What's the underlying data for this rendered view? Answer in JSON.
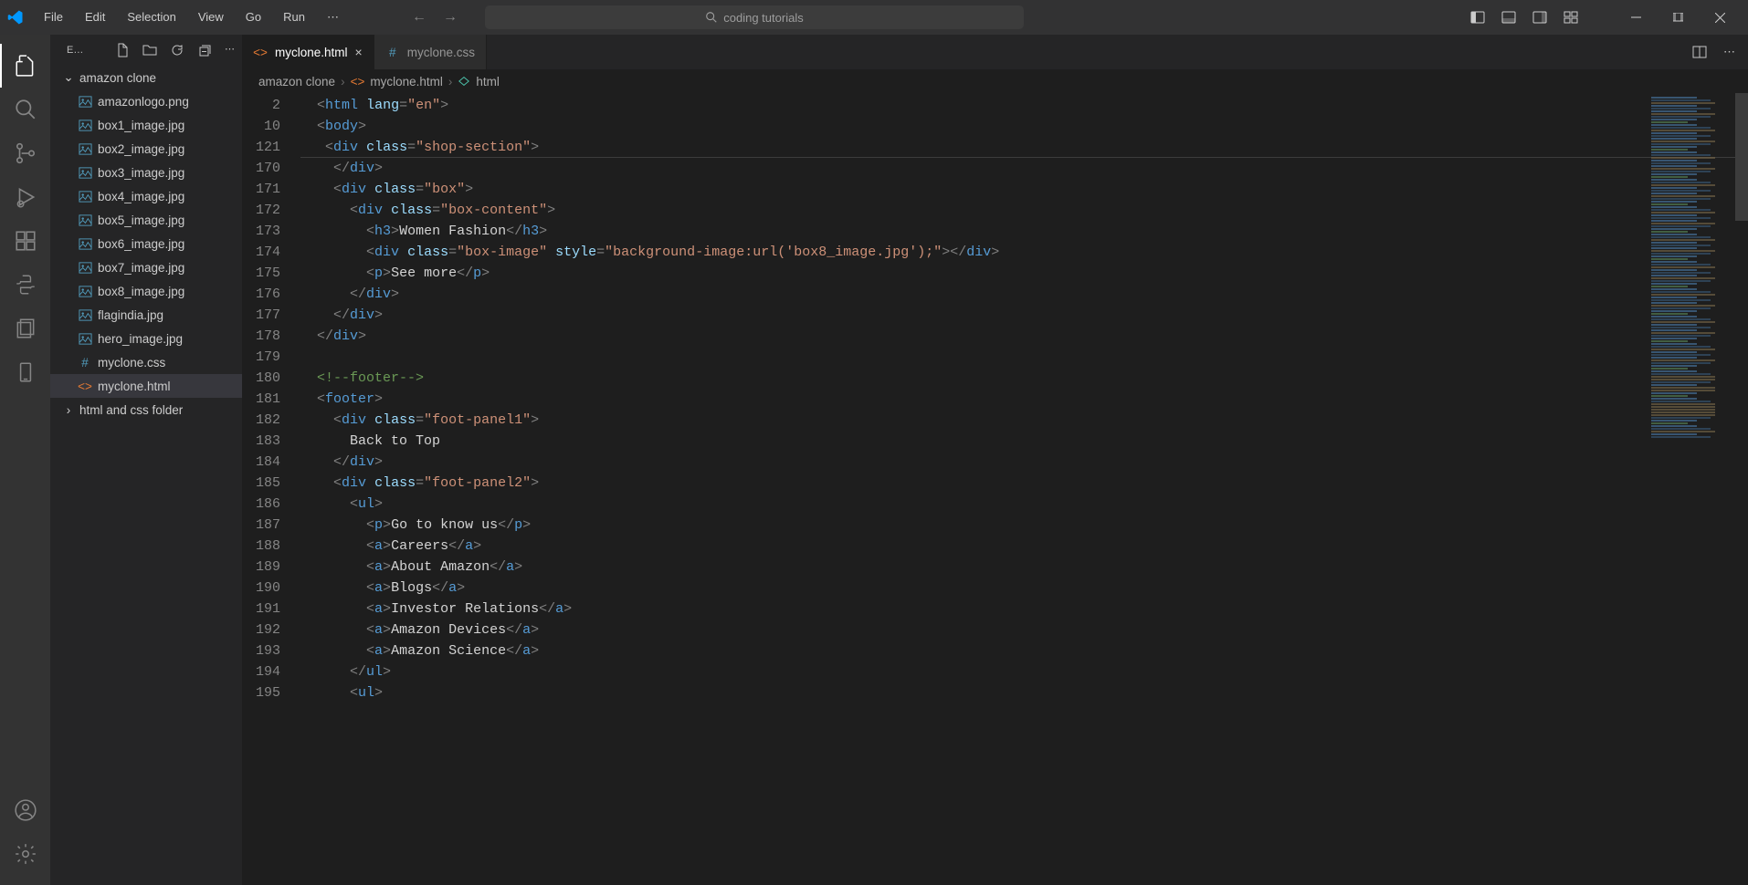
{
  "menu": {
    "items": [
      "File",
      "Edit",
      "Selection",
      "View",
      "Go",
      "Run"
    ]
  },
  "search": {
    "placeholder": "coding tutorials"
  },
  "sidebar": {
    "title": "E…",
    "folder": "amazon clone",
    "files": [
      {
        "name": "amazonlogo.png",
        "icon": "img"
      },
      {
        "name": "box1_image.jpg",
        "icon": "img"
      },
      {
        "name": "box2_image.jpg",
        "icon": "img"
      },
      {
        "name": "box3_image.jpg",
        "icon": "img"
      },
      {
        "name": "box4_image.jpg",
        "icon": "img"
      },
      {
        "name": "box5_image.jpg",
        "icon": "img"
      },
      {
        "name": "box6_image.jpg",
        "icon": "img"
      },
      {
        "name": "box7_image.jpg",
        "icon": "img"
      },
      {
        "name": "box8_image.jpg",
        "icon": "img"
      },
      {
        "name": "flagindia.jpg",
        "icon": "img"
      },
      {
        "name": "hero_image.jpg",
        "icon": "img"
      },
      {
        "name": "myclone.css",
        "icon": "css"
      },
      {
        "name": "myclone.html",
        "icon": "html",
        "selected": true
      }
    ],
    "folder2": "html and css folder"
  },
  "tabs": [
    {
      "label": "myclone.html",
      "icon": "html",
      "active": true,
      "close": true
    },
    {
      "label": "myclone.css",
      "icon": "css",
      "active": false,
      "close": false
    }
  ],
  "breadcrumb": {
    "parts": [
      "amazon clone",
      "myclone.html",
      "html"
    ]
  },
  "lineNumbers": [
    "2",
    "10",
    "121",
    "170",
    "171",
    "172",
    "173",
    "174",
    "175",
    "176",
    "177",
    "178",
    "179",
    "180",
    "181",
    "182",
    "183",
    "184",
    "185",
    "186",
    "187",
    "188",
    "189",
    "190",
    "191",
    "192",
    "193",
    "194",
    "195"
  ],
  "code": {
    "l2": {
      "tag": "html",
      "attr": "lang",
      "val": "\"en\""
    },
    "l10": {
      "tag": "body"
    },
    "l121": {
      "tag": "div",
      "attr": "class",
      "val": "\"shop-section\""
    },
    "l170": {
      "closeTag": "div"
    },
    "l171": {
      "tag": "div",
      "attr": "class",
      "val": "\"box\""
    },
    "l172": {
      "tag": "div",
      "attr": "class",
      "val": "\"box-content\""
    },
    "l173": {
      "tag": "h3",
      "text": "Women Fashion",
      "closeTag": "h3"
    },
    "l174": {
      "tag": "div",
      "attr1": "class",
      "val1": "\"box-image\"",
      "attr2": "style",
      "val2": "\"background-image:url('box8_image.jpg');\"",
      "closeTag": "div"
    },
    "l175": {
      "tag": "p",
      "text": "See more",
      "closeTag": "p"
    },
    "l176": {
      "closeTag": "div"
    },
    "l177": {
      "closeTag": "div"
    },
    "l178": {
      "closeTag": "div"
    },
    "l180": {
      "comment": "<!--footer-->"
    },
    "l181": {
      "tag": "footer"
    },
    "l182": {
      "tag": "div",
      "attr": "class",
      "val": "\"foot-panel1\""
    },
    "l183": {
      "text": "Back to Top"
    },
    "l184": {
      "closeTag": "div"
    },
    "l185": {
      "tag": "div",
      "attr": "class",
      "val": "\"foot-panel2\""
    },
    "l186": {
      "tag": "ul"
    },
    "l187": {
      "tag": "p",
      "text": "Go to know us",
      "closeTag": "p"
    },
    "l188": {
      "tag": "a",
      "text": "Careers",
      "closeTag": "a"
    },
    "l189": {
      "tag": "a",
      "text": "About Amazon",
      "closeTag": "a"
    },
    "l190": {
      "tag": "a",
      "text": "Blogs",
      "closeTag": "a"
    },
    "l191": {
      "tag": "a",
      "text": "Investor Relations",
      "closeTag": "a"
    },
    "l192": {
      "tag": "a",
      "text": "Amazon Devices",
      "closeTag": "a"
    },
    "l193": {
      "tag": "a",
      "text": "Amazon Science",
      "closeTag": "a"
    },
    "l194": {
      "closeTag": "ul"
    },
    "l195": {
      "tag": "ul"
    }
  }
}
